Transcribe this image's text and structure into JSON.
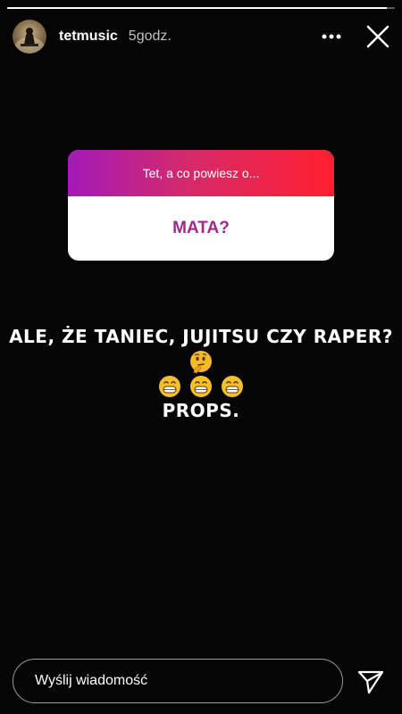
{
  "story": {
    "progress_fraction": 0.98,
    "username": "tetmusic",
    "time_ago": "5godz.",
    "avatar_icon": "avatar-photo"
  },
  "question_sticker": {
    "prompt": "Tet, a co powiesz o...",
    "answer": "MATA?",
    "gradient_colors": [
      "#a21ab8",
      "#d52a6a",
      "#ff1f2e"
    ],
    "answer_color": "#9e2b8c"
  },
  "story_text": {
    "line1": "ALE, ŻE TANIEC, JUJITSU CZY RAPER?",
    "line3": "PROPS.",
    "emoji_line1": "thinking-face",
    "emoji_line2": [
      "grinning-face",
      "grinning-face",
      "grinning-face"
    ]
  },
  "footer": {
    "message_placeholder": "Wyślij wiadomość",
    "send_icon": "paper-plane-icon"
  },
  "icons": {
    "more": "more-dots-icon",
    "close": "close-icon"
  }
}
